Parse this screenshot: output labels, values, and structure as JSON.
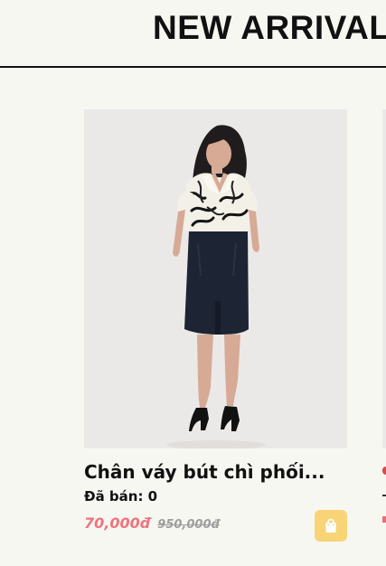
{
  "section": {
    "title": "NEW ARRIVAL"
  },
  "product": {
    "name": "Chân váy bút chì phối...",
    "sold_text": "Đã bán: 0",
    "sale_price": "70,000đ",
    "original_price": "950,000đ"
  },
  "colors": {
    "sale_price": "#f0737c",
    "cart_button": "#f8d477",
    "background": "#f7f7f2"
  },
  "icons": {
    "cart": "shopping-bag-icon"
  }
}
